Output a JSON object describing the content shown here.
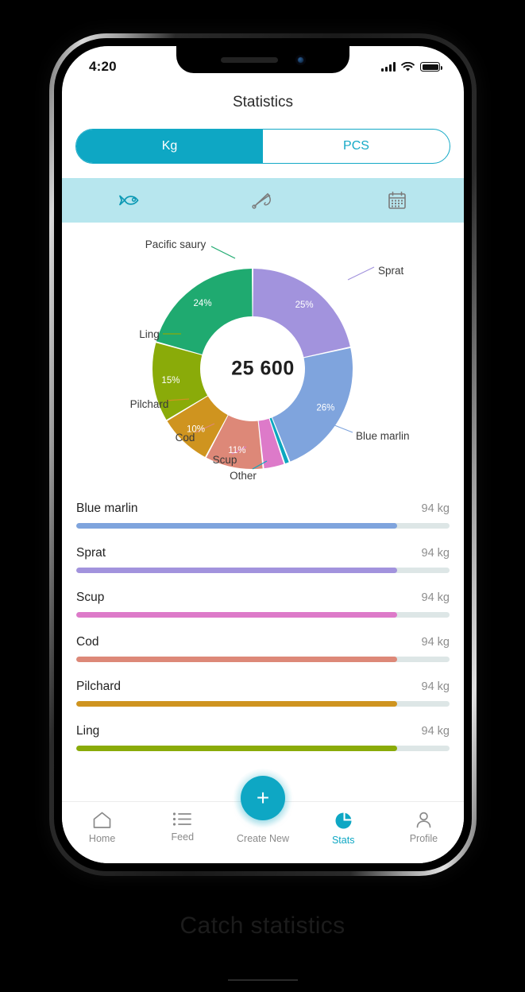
{
  "statusbar": {
    "time": "4:20",
    "signal_icon": "signal-bars-icon",
    "wifi_icon": "wifi-icon",
    "battery_icon": "battery-full-icon"
  },
  "header": {
    "title": "Statistics"
  },
  "unit_toggle": {
    "options": [
      "Kg",
      "PCS"
    ],
    "selected": "Kg"
  },
  "category_tabs": [
    {
      "icon": "fish-icon",
      "active": true
    },
    {
      "icon": "fishing-rod-icon",
      "active": false
    },
    {
      "icon": "calendar-icon",
      "active": false
    }
  ],
  "donut": {
    "center_value": "25 600"
  },
  "chart_data": {
    "type": "pie",
    "title": "Catch distribution by species",
    "center_label": "25 600",
    "unit": "kg",
    "legend_position": "callout-labels",
    "categories": [
      "Sprat",
      "Blue marlin",
      "Other",
      "Scup",
      "Cod",
      "Pilchard",
      "Ling",
      "Pacific saury"
    ],
    "values": [
      25,
      26,
      1,
      4,
      11,
      10,
      15,
      24
    ],
    "value_labels": [
      "25%",
      "26%",
      "",
      "",
      "11%",
      "10%",
      "15%",
      "24%"
    ],
    "colors": [
      "#a293dd",
      "#7fa4dd",
      "#0ca7bf",
      "#dd7ac9",
      "#dd8878",
      "#cf941f",
      "#8aab09",
      "#1faa70"
    ]
  },
  "species": {
    "unit": "kg",
    "rows": [
      {
        "name": "Blue marlin",
        "value": "94 kg",
        "percent": 86,
        "color": "#7fa4dd"
      },
      {
        "name": "Sprat",
        "value": "94 kg",
        "percent": 86,
        "color": "#a293dd"
      },
      {
        "name": "Scup",
        "value": "94 kg",
        "percent": 86,
        "color": "#dd7ac9"
      },
      {
        "name": "Cod",
        "value": "94 kg",
        "percent": 86,
        "color": "#dd8878"
      },
      {
        "name": "Pilchard",
        "value": "94 kg",
        "percent": 86,
        "color": "#cf941f"
      },
      {
        "name": "Ling",
        "value": "94 kg",
        "percent": 86,
        "color": "#8aab09"
      }
    ]
  },
  "bottomnav": {
    "items": [
      {
        "label": "Home",
        "icon": "home-icon",
        "active": false
      },
      {
        "label": "Feed",
        "icon": "list-icon",
        "active": false
      },
      {
        "label": "Create New",
        "icon": "plus-icon",
        "active": false
      },
      {
        "label": "Stats",
        "icon": "pie-chart-icon",
        "active": true
      },
      {
        "label": "Profile",
        "icon": "person-icon",
        "active": false
      }
    ],
    "fab_label": "+"
  },
  "caption": {
    "text": "Catch statistics"
  },
  "colors": {
    "accent": "#0ea7c4",
    "tab_bar_bg": "#b7e6ee",
    "track": "#dde6e6"
  }
}
